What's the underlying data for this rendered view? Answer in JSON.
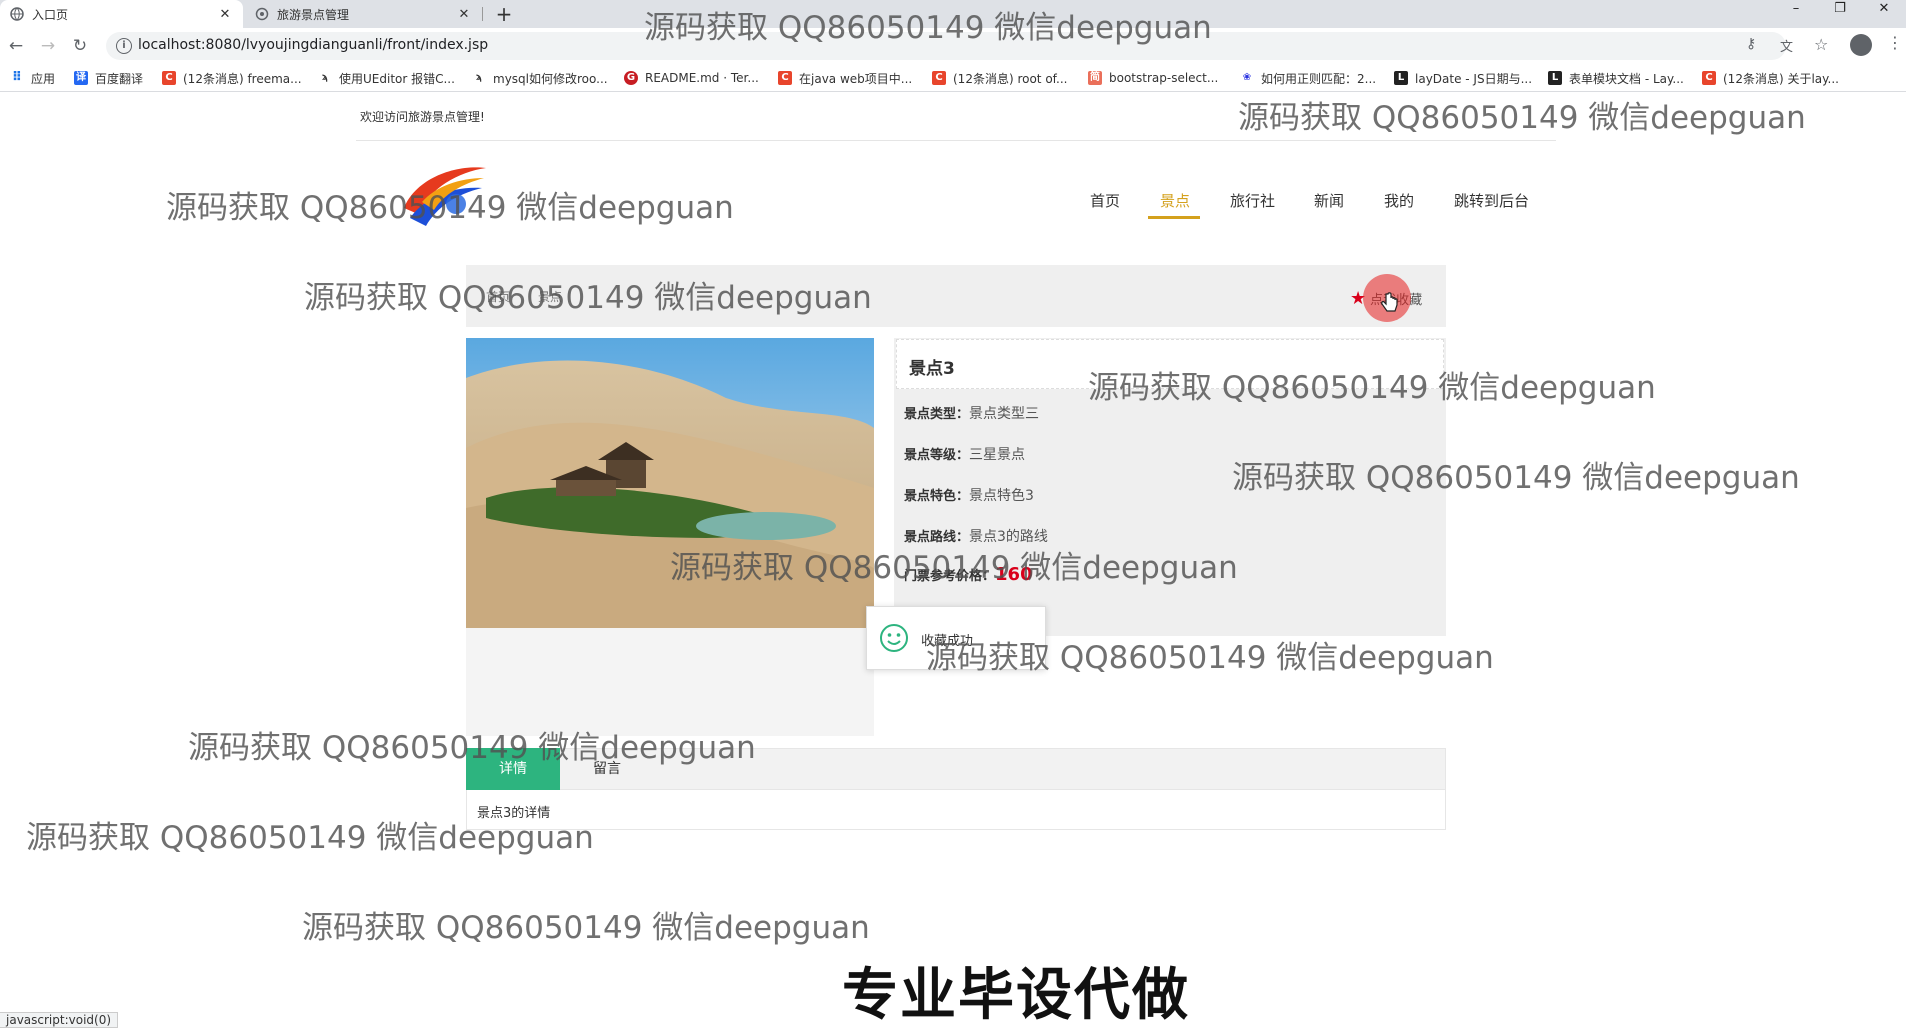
{
  "browser": {
    "tabs": [
      {
        "title": "入口页",
        "active": true
      },
      {
        "title": "旅游景点管理",
        "active": false
      }
    ],
    "url": "localhost:8080/lvyoujingdianguanli/front/index.jsp",
    "bookmarks": [
      {
        "label": "应用",
        "icon": "apps-grid-icon",
        "color": "#1a73e8"
      },
      {
        "label": "百度翻译",
        "icon": "baidu-translate-icon",
        "color": "#2468f2"
      },
      {
        "label": "(12条消息) freema...",
        "icon": "csdn-icon",
        "color": "#e8452c"
      },
      {
        "label": "使用UEditor 报错C...",
        "icon": "hook-icon",
        "color": "#333333"
      },
      {
        "label": "mysql如何修改roo...",
        "icon": "hook-icon",
        "color": "#333333"
      },
      {
        "label": "README.md · Ter...",
        "icon": "gitee-icon",
        "color": "#c71d23"
      },
      {
        "label": "在java web项目中...",
        "icon": "csdn-icon",
        "color": "#e8452c"
      },
      {
        "label": "(12条消息) root of...",
        "icon": "csdn-icon",
        "color": "#e8452c"
      },
      {
        "label": "bootstrap-select...",
        "icon": "jianshu-icon",
        "color": "#ea6f5a"
      },
      {
        "label": "如何用正则匹配：2...",
        "icon": "baidu-paw-icon",
        "color": "#2932e1"
      },
      {
        "label": "layDate - JS日期与...",
        "icon": "layui-icon",
        "color": "#222222"
      },
      {
        "label": "表单模块文档 - Lay...",
        "icon": "layui-icon",
        "color": "#222222"
      },
      {
        "label": "(12条消息) 关于lay...",
        "icon": "csdn-icon",
        "color": "#e8452c"
      }
    ],
    "status_text": "javascript:void(0)"
  },
  "header": {
    "welcome": "欢迎访问旅游景点管理!",
    "nav": [
      {
        "label": "首页",
        "active": false
      },
      {
        "label": "景点",
        "active": true
      },
      {
        "label": "旅行社",
        "active": false
      },
      {
        "label": "新闻",
        "active": false
      },
      {
        "label": "我的",
        "active": false
      },
      {
        "label": "跳转到后台",
        "active": false
      }
    ]
  },
  "breadcrumb": {
    "items": [
      "首页",
      "景点"
    ],
    "favorite_label": "点我收藏"
  },
  "attraction": {
    "name": "景点3",
    "fields": [
      {
        "label": "景点类型：",
        "value": "景点类型三"
      },
      {
        "label": "景点等级：",
        "value": "三星景点"
      },
      {
        "label": "景点特色：",
        "value": "景点特色3"
      },
      {
        "label": "景点路线：",
        "value": "景点3的路线"
      }
    ],
    "price_label": "门票参考价格：",
    "price": "160"
  },
  "toast": {
    "message": "收藏成功"
  },
  "detail_tabs": {
    "tabs": [
      {
        "label": "详情",
        "active": true
      },
      {
        "label": "留言",
        "active": false
      }
    ],
    "content": "景点3的详情"
  },
  "overlay": {
    "watermark": "源码获取 QQ86050149 微信deepguan",
    "promo": "专业毕设代做"
  },
  "colors": {
    "accent": "#d4a11d",
    "tab_green": "#2db47f",
    "price_red": "#d9001b"
  }
}
